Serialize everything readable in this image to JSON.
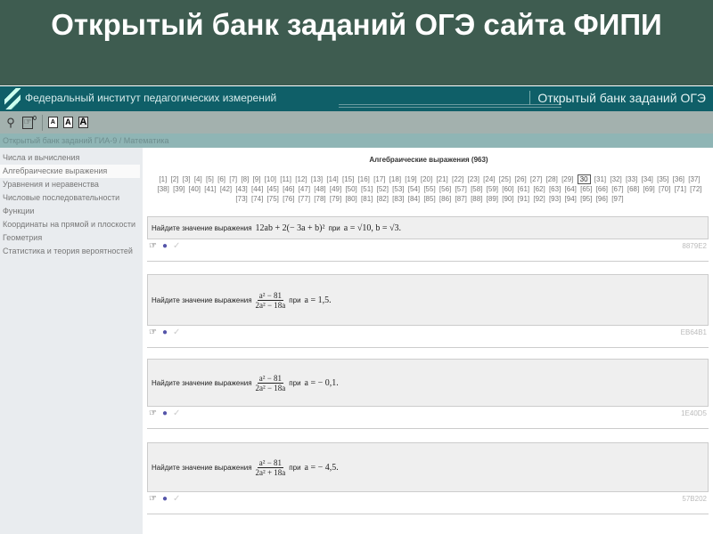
{
  "slide_title": "Открытый банк заданий ОГЭ сайта ФИПИ",
  "header": {
    "org": "Федеральный институт педагогических измерений",
    "bank": "Открытый банк заданий ОГЭ"
  },
  "toolbar": {
    "search_icon": "search-icon",
    "cart_icon": "cart-icon",
    "cart_count": "0",
    "font_small": "A",
    "font_medium": "A",
    "font_large": "A"
  },
  "breadcrumb": "Открытый банк заданий ГИА-9 / Математика",
  "sidebar": {
    "items": [
      "Числа и вычисления",
      "Алгебраические выражения",
      "Уравнения и неравенства",
      "Числовые последовательности",
      "Функции",
      "Координаты на прямой и плоскости",
      "Геометрия",
      "Статистика и теория вероятностей"
    ],
    "active": 1
  },
  "section_title": "Алгебраические выражения (963)",
  "pagination": {
    "current": 30,
    "total": 97
  },
  "tasks": [
    {
      "prompt": "Найдите значение выражения",
      "expr": "12ab + 2(− 3a + b)²",
      "cond": "при",
      "values": "a = √10, b = √3.",
      "id": "8879E2"
    },
    {
      "prompt": "Найдите значение выражения",
      "num": "a² − 81",
      "den": "2a² − 18a",
      "cond": "при",
      "values": "a = 1,5.",
      "id": "EB64B1"
    },
    {
      "prompt": "Найдите значение выражения",
      "num": "a² − 81",
      "den": "2a² − 18a",
      "cond": "при",
      "values": "a = − 0,1.",
      "id": "1E40D5"
    },
    {
      "prompt": "Найдите значение выражения",
      "num": "a² − 81",
      "den": "2a² + 18a",
      "cond": "при",
      "values": "a = − 4,5.",
      "id": "57B202"
    }
  ]
}
